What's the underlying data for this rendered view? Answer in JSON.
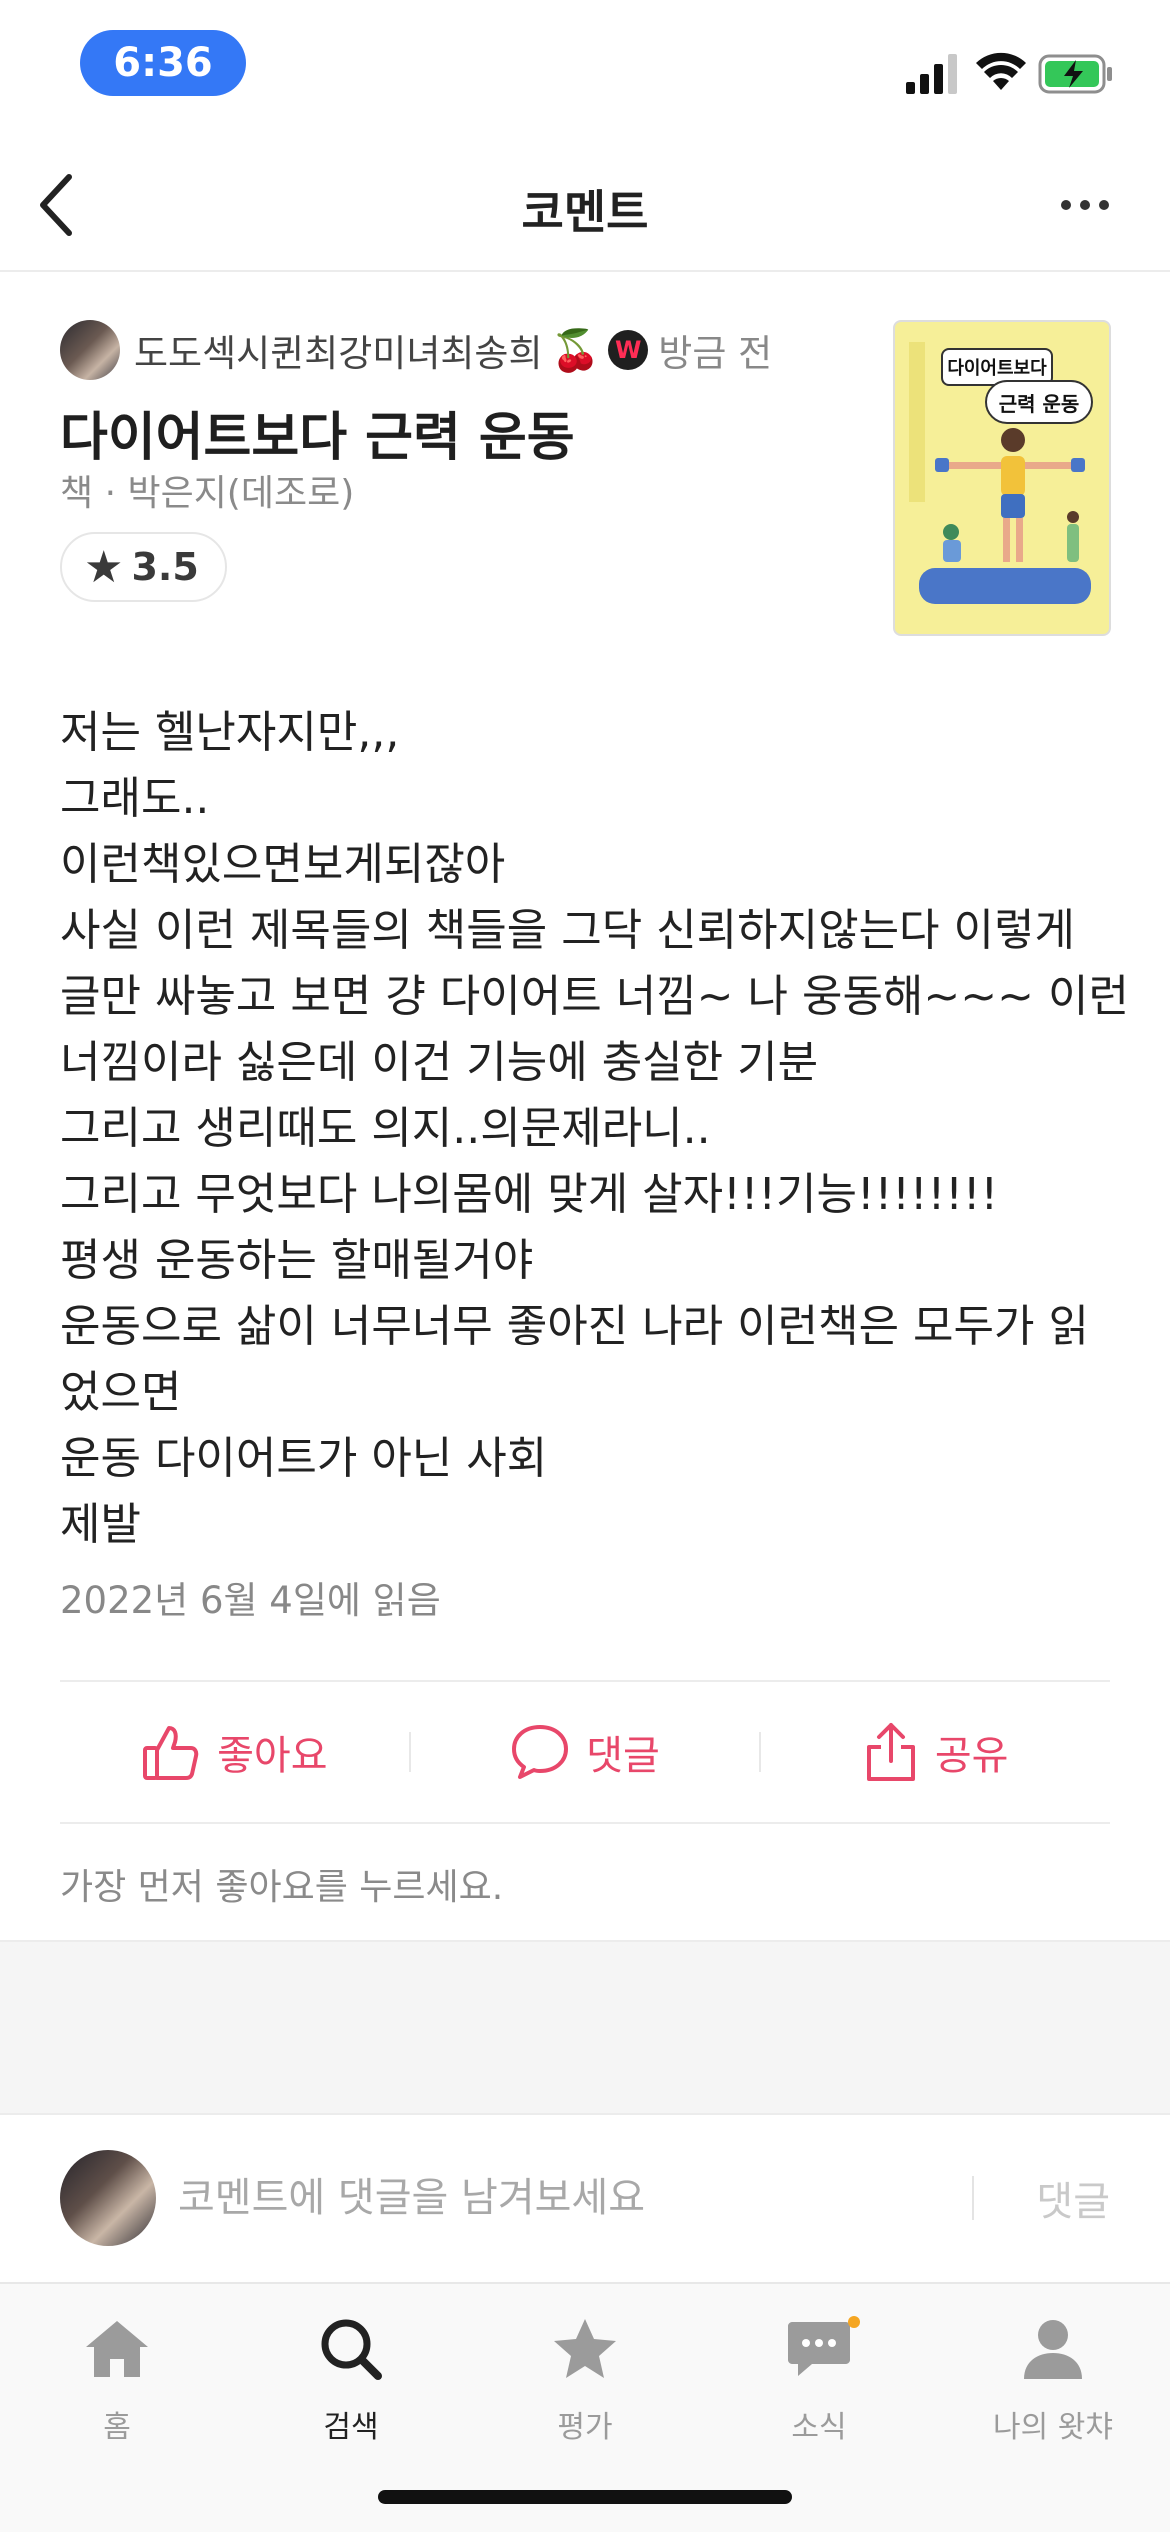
{
  "status_bar": {
    "time": "6:36"
  },
  "nav": {
    "title": "코멘트"
  },
  "comment": {
    "author": "도도섹시퀸최강미녀최송희",
    "author_badge": "W",
    "time_ago": "방금 전",
    "book_title": "다이어트보다 근력 운동",
    "book_meta": "책 · 박은지(데조로)",
    "rating": "3.5",
    "cover": {
      "title_line1": "다이어트보다",
      "title_line2": "근력 운동"
    },
    "body_lines": [
      "저는 헬난자지만,,,",
      "그래도..",
      "이런책있으면보게되잖아",
      "사실 이런 제목들의 책들을 그닥 신뢰하지않는다 이렇게",
      "글만 싸놓고 보면 걍 다이어트 너낌~ 나 웅동해~~~ 이런",
      "너낌이라 싫은데 이건 기능에 충실한 기분",
      "그리고 생리때도 의지..의문제라니..",
      "그리고 무엇보다 나의몸에 맞게 살자!!!기능!!!!!!!!",
      "평생 운동하는 할매될거야",
      "운동으로 삶이 너무너무 좋아진 나라 이런책은 모두가 읽",
      "었으면",
      "운동 다이어트가 아닌 사회",
      "제발"
    ],
    "read_date": "2022년 6월 4일에 읽음"
  },
  "actions": {
    "like": "좋아요",
    "comment": "댓글",
    "share": "공유"
  },
  "like_hint": "가장 먼저 좋아요를 누르세요.",
  "reply": {
    "placeholder": "코멘트에 댓글을 남겨보세요",
    "submit": "댓글"
  },
  "tabs": [
    {
      "label": "홈",
      "icon": "home-icon"
    },
    {
      "label": "검색",
      "icon": "search-icon"
    },
    {
      "label": "평가",
      "icon": "star-icon"
    },
    {
      "label": "소식",
      "icon": "chat-icon"
    },
    {
      "label": "나의 왓챠",
      "icon": "profile-icon"
    }
  ],
  "colors": {
    "accent": "#e8476a",
    "status_pill": "#3478f6",
    "battery": "#34c759"
  }
}
